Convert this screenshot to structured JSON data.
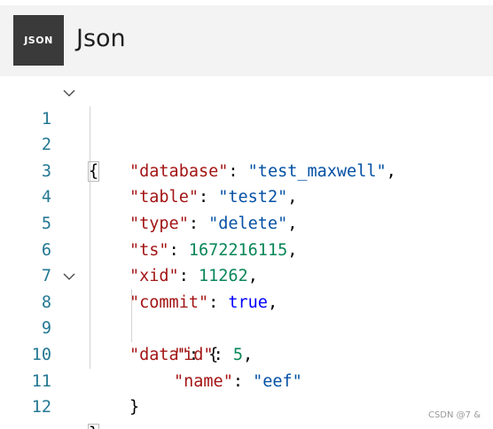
{
  "header": {
    "logo_text": "JSON",
    "title": "Json"
  },
  "editor": {
    "line_numbers": [
      "1",
      "2",
      "3",
      "4",
      "5",
      "6",
      "7",
      "8",
      "9",
      "10",
      "11",
      "12"
    ],
    "lines": [
      {
        "num": "1"
      },
      {
        "key": "\"database\"",
        "value": "\"test_maxwell\""
      },
      {
        "key": "\"table\"",
        "value": "\"test2\""
      },
      {
        "key": "\"type\"",
        "value": "\"delete\""
      },
      {
        "key": "\"ts\"",
        "value": "1672216115"
      },
      {
        "key": "\"xid\"",
        "value": "11262"
      },
      {
        "key": "\"commit\"",
        "value": "true"
      },
      {
        "key": "\"data\""
      },
      {
        "key": "\"id\"",
        "value": "5"
      },
      {
        "key": "\"name\"",
        "value": "\"eef\""
      }
    ],
    "punct": {
      "open_brace": "{",
      "close_brace": "}",
      "colon": ": ",
      "comma": ","
    }
  },
  "watermark": "CSDN @7 &",
  "colors": {
    "key": "#a31515",
    "string": "#0451a5",
    "number": "#098658",
    "boolean": "#0000ff",
    "line_number": "#237893",
    "header_bg": "#f3f3f3",
    "logo_bg": "#3a3a3a"
  },
  "icons": {
    "fold": "chevron-down-icon"
  }
}
